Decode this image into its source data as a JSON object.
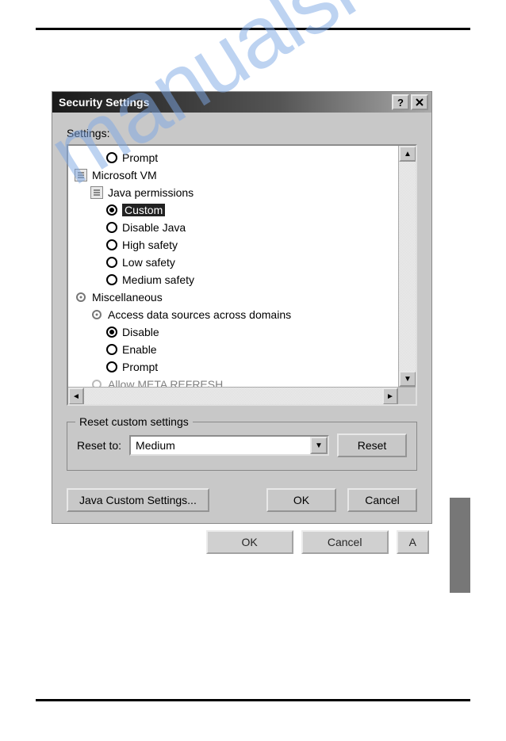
{
  "titlebar": {
    "title": "Security Settings"
  },
  "labels": {
    "settings": "Settings:"
  },
  "tree": {
    "prompt": "Prompt",
    "msvm": "Microsoft VM",
    "javaperm": "Java permissions",
    "custom": "Custom",
    "disablejava": "Disable Java",
    "highsafety": "High safety",
    "lowsafety": "Low safety",
    "medsafety": "Medium safety",
    "misc": "Miscellaneous",
    "access": "Access data sources across domains",
    "disable": "Disable",
    "enable": "Enable",
    "prompt2": "Prompt",
    "meta": "Allow META REFRESH"
  },
  "fieldset": {
    "legend": "Reset custom settings",
    "resetto": "Reset to:",
    "combovalue": "Medium",
    "resetbtn": "Reset"
  },
  "buttons": {
    "javacustom": "Java Custom Settings...",
    "ok": "OK",
    "cancel": "Cancel"
  },
  "parent": {
    "ok": "OK",
    "cancel": "Cancel",
    "apply": "A"
  },
  "watermark": "manualshive.com"
}
